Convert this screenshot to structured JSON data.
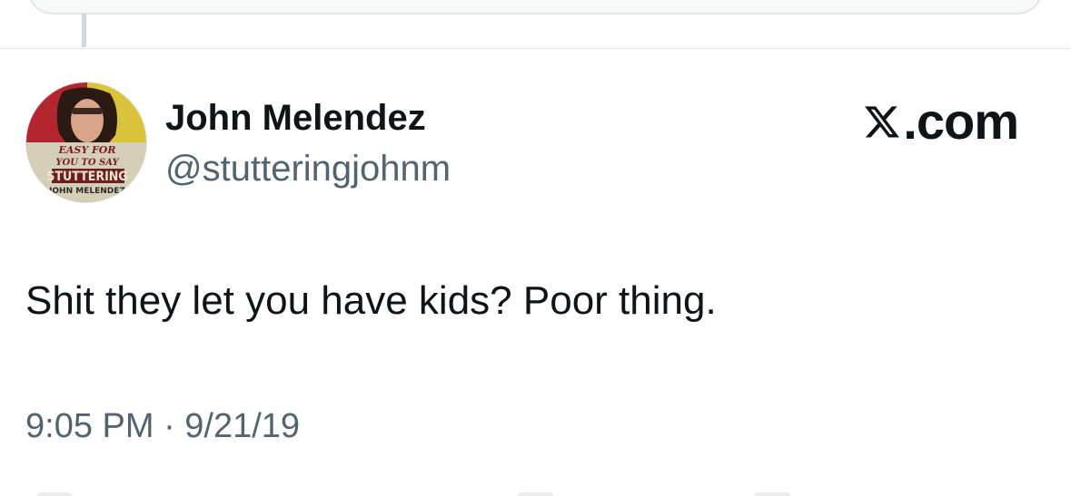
{
  "author": {
    "name": "John Melendez",
    "handle": "@stutteringjohnm",
    "avatar_alt": "book cover avatar"
  },
  "brand": {
    "label": ".com"
  },
  "tweet": {
    "text": "Shit they let you have kids? Poor thing.",
    "timestamp": "9:05 PM · 9/21/19"
  },
  "avatar_cover": {
    "line1": "EASY FOR",
    "line2": "YOU TO SAY",
    "line3": "STUTTERING",
    "line4": "JOHN MELENDEZ"
  },
  "colors": {
    "text_primary": "#0f1419",
    "text_secondary": "#536471",
    "divider": "#e6eaec"
  }
}
